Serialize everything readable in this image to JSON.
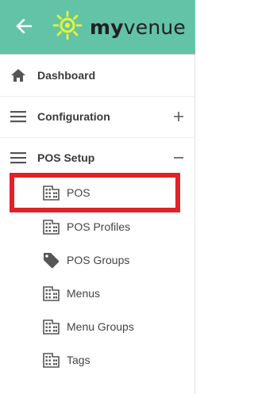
{
  "header": {
    "back_icon": "arrow-left-icon",
    "logo_icon": "sun-logo-icon",
    "logo_part_my": "my",
    "logo_part_venue": "venue",
    "background_color": "#63c3a6",
    "logo_accent_color": "#e4f23a"
  },
  "nav": {
    "items": [
      {
        "label": "Dashboard",
        "icon": "home-icon",
        "toggle": ""
      },
      {
        "label": "Configuration",
        "icon": "hamburger-menu-icon",
        "toggle": "+"
      },
      {
        "label": "POS Setup",
        "icon": "hamburger-menu-icon",
        "toggle": "−"
      }
    ]
  },
  "pos_setup": {
    "sub_items": [
      {
        "label": "POS",
        "icon": "building-icon"
      },
      {
        "label": "POS Profiles",
        "icon": "building-icon"
      },
      {
        "label": "POS Groups",
        "icon": "tag-icon"
      },
      {
        "label": "Menus",
        "icon": "building-icon"
      },
      {
        "label": "Menu Groups",
        "icon": "building-icon"
      },
      {
        "label": "Tags",
        "icon": "building-icon"
      }
    ]
  },
  "highlight": {
    "target": "POS",
    "color": "#e3202b"
  }
}
